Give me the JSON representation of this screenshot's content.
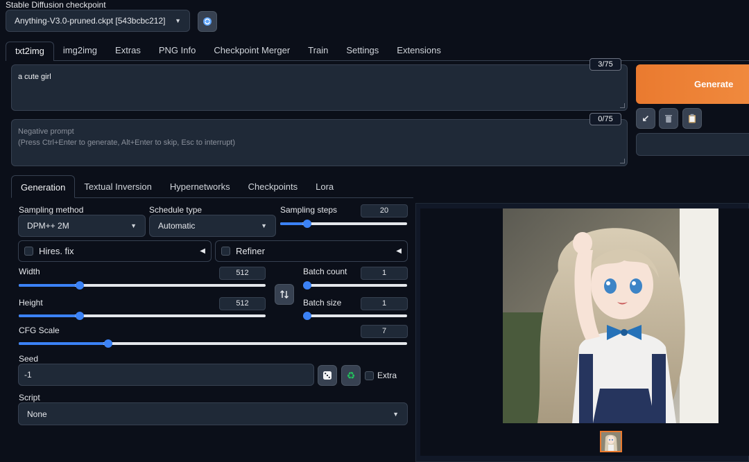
{
  "checkpoint": {
    "label": "Stable Diffusion checkpoint",
    "value": "Anything-V3.0-pruned.ckpt [543bcbc212]"
  },
  "main_tabs": [
    "txt2img",
    "img2img",
    "Extras",
    "PNG Info",
    "Checkpoint Merger",
    "Train",
    "Settings",
    "Extensions"
  ],
  "prompt": {
    "value": "a cute girl",
    "token_count": "3/75"
  },
  "negative_prompt": {
    "placeholder_line1": "Negative prompt",
    "placeholder_line2": "(Press Ctrl+Enter to generate, Alt+Enter to skip, Esc to interrupt)",
    "token_count": "0/75"
  },
  "actions": {
    "generate_label": "Generate"
  },
  "sub_tabs": [
    "Generation",
    "Textual Inversion",
    "Hypernetworks",
    "Checkpoints",
    "Lora"
  ],
  "generation": {
    "sampling_method_label": "Sampling method",
    "sampling_method_value": "DPM++ 2M",
    "schedule_type_label": "Schedule type",
    "schedule_type_value": "Automatic",
    "sampling_steps_label": "Sampling steps",
    "sampling_steps_value": "20",
    "hires_fix_label": "Hires. fix",
    "refiner_label": "Refiner",
    "width_label": "Width",
    "width_value": "512",
    "height_label": "Height",
    "height_value": "512",
    "batch_count_label": "Batch count",
    "batch_count_value": "1",
    "batch_size_label": "Batch size",
    "batch_size_value": "1",
    "cfg_scale_label": "CFG Scale",
    "cfg_scale_value": "7",
    "seed_label": "Seed",
    "seed_value": "-1",
    "extra_label": "Extra",
    "script_label": "Script",
    "script_value": "None"
  },
  "slider_levels": {
    "sampling_steps": 0.18,
    "width": 0.23,
    "height": 0.23,
    "cfg_scale": 0.22,
    "batch_count": 0.0,
    "batch_size": 0.0
  },
  "colors": {
    "accent": "#3b82f6",
    "generate": "#ea7a2f",
    "background": "#0b0f19"
  },
  "icons": {
    "refresh": "refresh-icon",
    "swap": "swap-icon",
    "dice": "dice-icon",
    "recycle": "recycle-icon",
    "arrow": "arrow-down-left-icon",
    "trash": "trash-icon",
    "clipboard": "clipboard-icon"
  }
}
